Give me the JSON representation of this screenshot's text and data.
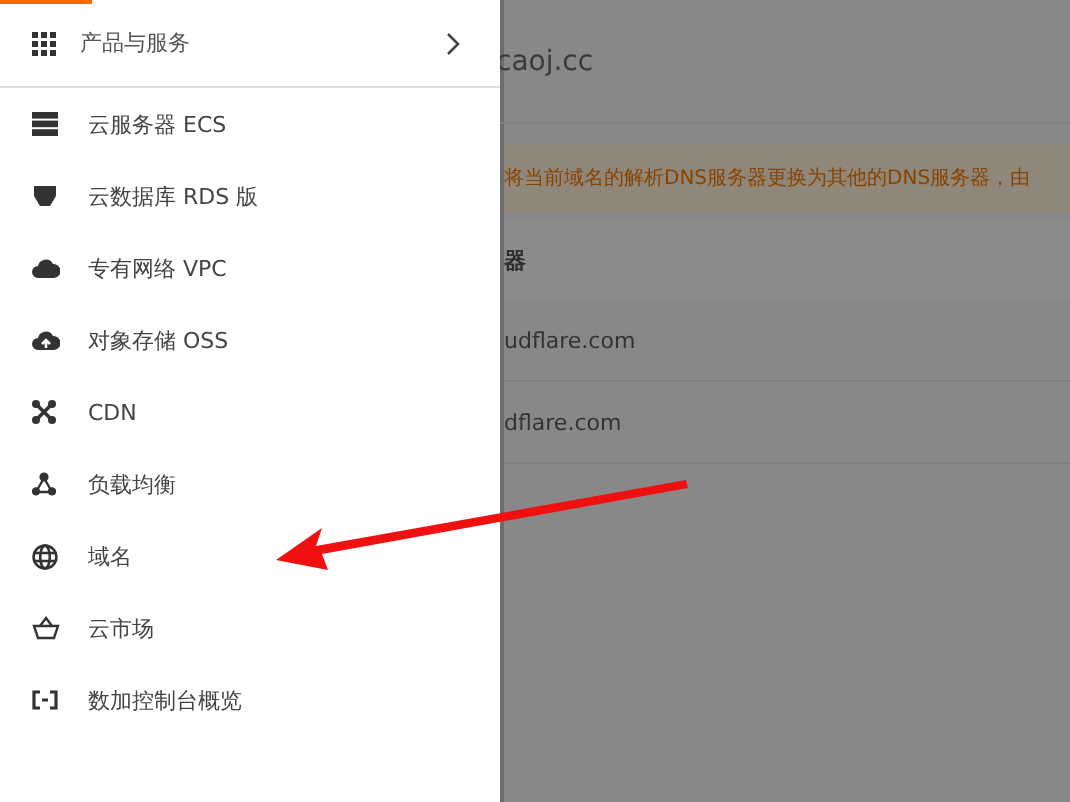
{
  "menu": {
    "header": {
      "label": "产品与服务"
    },
    "items": [
      {
        "label": "云服务器 ECS",
        "kind": "server"
      },
      {
        "label": "云数据库 RDS 版",
        "kind": "database"
      },
      {
        "label": "专有网络 VPC",
        "kind": "cloud"
      },
      {
        "label": "对象存储 OSS",
        "kind": "storage"
      },
      {
        "label": "CDN",
        "kind": "cdn"
      },
      {
        "label": "负载均衡",
        "kind": "balance"
      },
      {
        "label": "域名",
        "kind": "globe"
      },
      {
        "label": "云市场",
        "kind": "market"
      },
      {
        "label": "数加控制台概览",
        "kind": "bracket"
      }
    ]
  },
  "page": {
    "domain": "caoj.cc",
    "notice": "将当前域名的解析DNS服务器更换为其他的DNS服务器，由",
    "column_1": "器",
    "rows": [
      "udflare.com",
      "dflare.com"
    ]
  }
}
